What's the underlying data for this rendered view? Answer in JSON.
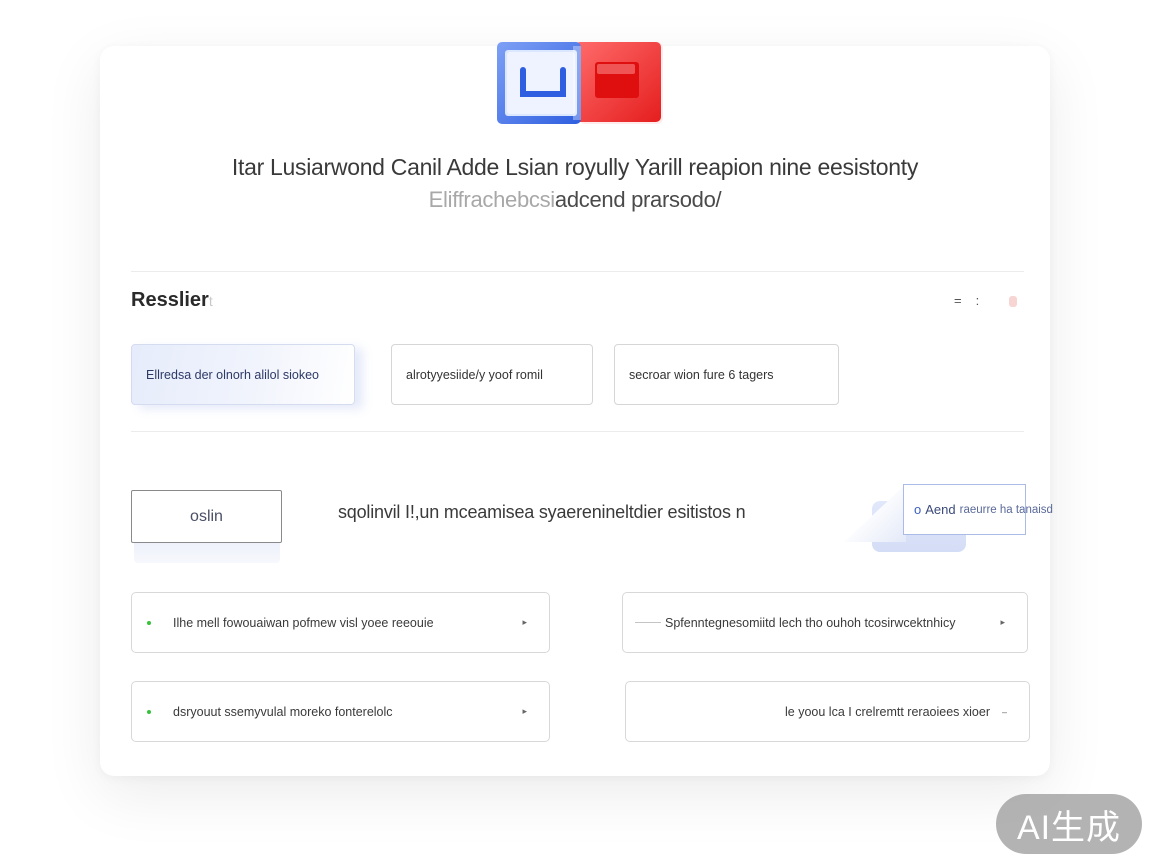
{
  "header": {
    "headline_line1": "Itar Lusiarwond Canil Adde Lsian royully Yarill reapion nine eesistonty",
    "headline_line2_faint": "Eliffrachebcsi",
    "headline_line2_main": "adcend prarsodo/"
  },
  "section": {
    "title": "Resslier",
    "title_ghost": "t",
    "icon_a": "=",
    "icon_b": ":"
  },
  "chips": [
    {
      "label": "Ellredsa der olnorh alilol siokeo",
      "selected": true
    },
    {
      "label": "alrotyyesiide/y yoof romil",
      "selected": false
    },
    {
      "label": "secroar wion fure 6 tagers",
      "selected": false
    }
  ],
  "controls": {
    "primary_button": "oslin",
    "middle_text": "sqolinvil I!,un mceamisea syaerenineltdier esitistos n",
    "action_circle": "o",
    "action_label": "Aend",
    "action_sub": "raeurre ha tanaisd"
  },
  "options": [
    {
      "label": "Ilhe mell fowouaiwan pofmew visl yoee reeouie",
      "arrow": "▸"
    },
    {
      "label": "Spfenntegnesomiitd lech tho ouhoh tcosirwcektnhicy",
      "arrow": "▸"
    },
    {
      "label": "dsryouut ssemyvulal moreko fonterelolc",
      "arrow": "▸"
    },
    {
      "label": "le yoou lca I crelremtt reraoiees xioer",
      "arrow": "–"
    }
  ],
  "watermark": "AI生成",
  "colors": {
    "accent_blue": "#3b6fe0",
    "accent_red": "#ef2a2a",
    "bullet_green": "#36c23b"
  }
}
